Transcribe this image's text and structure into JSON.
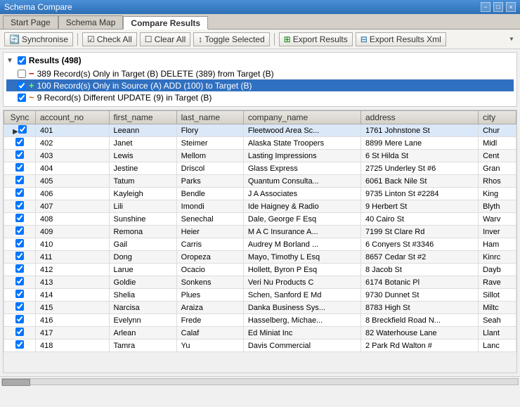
{
  "titlebar": {
    "title": "Schema Compare",
    "buttons": [
      "-",
      "□",
      "×"
    ]
  },
  "tabs": [
    {
      "id": "start-page",
      "label": "Start Page",
      "active": false
    },
    {
      "id": "schema-map",
      "label": "Schema Map",
      "active": false
    },
    {
      "id": "compare-results",
      "label": "Compare Results",
      "active": true
    }
  ],
  "toolbar": {
    "synchronise_label": "Synchronise",
    "check_all_label": "Check All",
    "clear_all_label": "Clear All",
    "toggle_selected_label": "Toggle Selected",
    "export_results_label": "Export Results",
    "export_results_xml_label": "Export Results Xml"
  },
  "results": {
    "title": "Results (498)",
    "rows": [
      {
        "icon": "minus",
        "text": "389 Record(s) Only in Target (B) DELETE (389) from Target (B)",
        "checked": false,
        "selected": false
      },
      {
        "icon": "plus",
        "text": "100 Record(s) Only in Source (A) ADD (100) to Target (B)",
        "checked": true,
        "selected": true
      },
      {
        "icon": "tilde",
        "text": "9 Record(s) Different UPDATE (9) in Target (B)",
        "checked": true,
        "selected": false
      }
    ]
  },
  "table": {
    "columns": [
      "Sync",
      "account_no",
      "first_name",
      "last_name",
      "company_name",
      "address",
      "city"
    ],
    "rows": [
      {
        "sync": true,
        "account_no": "401",
        "first_name": "Leeann",
        "last_name": "Flory",
        "company_name": "Fleetwood Area Sc...",
        "address": "1761 Johnstone St",
        "city": "Chur",
        "first": true
      },
      {
        "sync": true,
        "account_no": "402",
        "first_name": "Janet",
        "last_name": "Steimer",
        "company_name": "Alaska State Troopers",
        "address": "8899 Mere Lane",
        "city": "Midl"
      },
      {
        "sync": true,
        "account_no": "403",
        "first_name": "Lewis",
        "last_name": "Mellom",
        "company_name": "Lasting Impressions",
        "address": "6 St Hilda St",
        "city": "Cent"
      },
      {
        "sync": true,
        "account_no": "404",
        "first_name": "Jestine",
        "last_name": "Driscol",
        "company_name": "Glass Express",
        "address": "2725 Underley St #6",
        "city": "Gran"
      },
      {
        "sync": true,
        "account_no": "405",
        "first_name": "Tatum",
        "last_name": "Parks",
        "company_name": "Quantum Consulta...",
        "address": "6061 Back Nile St",
        "city": "Rhos"
      },
      {
        "sync": true,
        "account_no": "406",
        "first_name": "Kayleigh",
        "last_name": "Bendle",
        "company_name": "J A Associates",
        "address": "9735 Linton St #2284",
        "city": "King"
      },
      {
        "sync": true,
        "account_no": "407",
        "first_name": "Lili",
        "last_name": "Imondi",
        "company_name": "Ide Haigney & Radio",
        "address": "9 Herbert St",
        "city": "Blyth"
      },
      {
        "sync": true,
        "account_no": "408",
        "first_name": "Sunshine",
        "last_name": "Senechal",
        "company_name": "Dale, George F Esq",
        "address": "40 Cairo St",
        "city": "Warv"
      },
      {
        "sync": true,
        "account_no": "409",
        "first_name": "Remona",
        "last_name": "Heier",
        "company_name": "M A C Insurance A...",
        "address": "7199 St Clare Rd",
        "city": "Inver"
      },
      {
        "sync": true,
        "account_no": "410",
        "first_name": "Gail",
        "last_name": "Carris",
        "company_name": "Audrey M Borland ...",
        "address": "6 Conyers St #3346",
        "city": "Ham"
      },
      {
        "sync": true,
        "account_no": "411",
        "first_name": "Dong",
        "last_name": "Oropeza",
        "company_name": "Mayo, Timothy L Esq",
        "address": "8657 Cedar St #2",
        "city": "Kinrc"
      },
      {
        "sync": true,
        "account_no": "412",
        "first_name": "Larue",
        "last_name": "Ocacio",
        "company_name": "Hollett, Byron P Esq",
        "address": "8 Jacob St",
        "city": "Dayb"
      },
      {
        "sync": true,
        "account_no": "413",
        "first_name": "Goldie",
        "last_name": "Sonkens",
        "company_name": "Veri Nu Products C",
        "address": "6174 Botanic Pl",
        "city": "Rave"
      },
      {
        "sync": true,
        "account_no": "414",
        "first_name": "Shelia",
        "last_name": "Plues",
        "company_name": "Schen, Sanford E Md",
        "address": "9730 Dunnet St",
        "city": "Sillot"
      },
      {
        "sync": true,
        "account_no": "415",
        "first_name": "Narcisa",
        "last_name": "Araiza",
        "company_name": "Danka Business Sys...",
        "address": "8783 High St",
        "city": "Miltc"
      },
      {
        "sync": true,
        "account_no": "416",
        "first_name": "Evelynn",
        "last_name": "Frede",
        "company_name": "Hasselberg, Michae...",
        "address": "8 Breckfield Road N...",
        "city": "Seah"
      },
      {
        "sync": true,
        "account_no": "417",
        "first_name": "Arlean",
        "last_name": "Calaf",
        "company_name": "Ed Miniat Inc",
        "address": "82 Waterhouse Lane",
        "city": "Llant"
      },
      {
        "sync": true,
        "account_no": "418",
        "first_name": "Tamra",
        "last_name": "Yu",
        "company_name": "Davis Commercial",
        "address": "2 Park Rd Walton #",
        "city": "Lanc"
      }
    ]
  }
}
